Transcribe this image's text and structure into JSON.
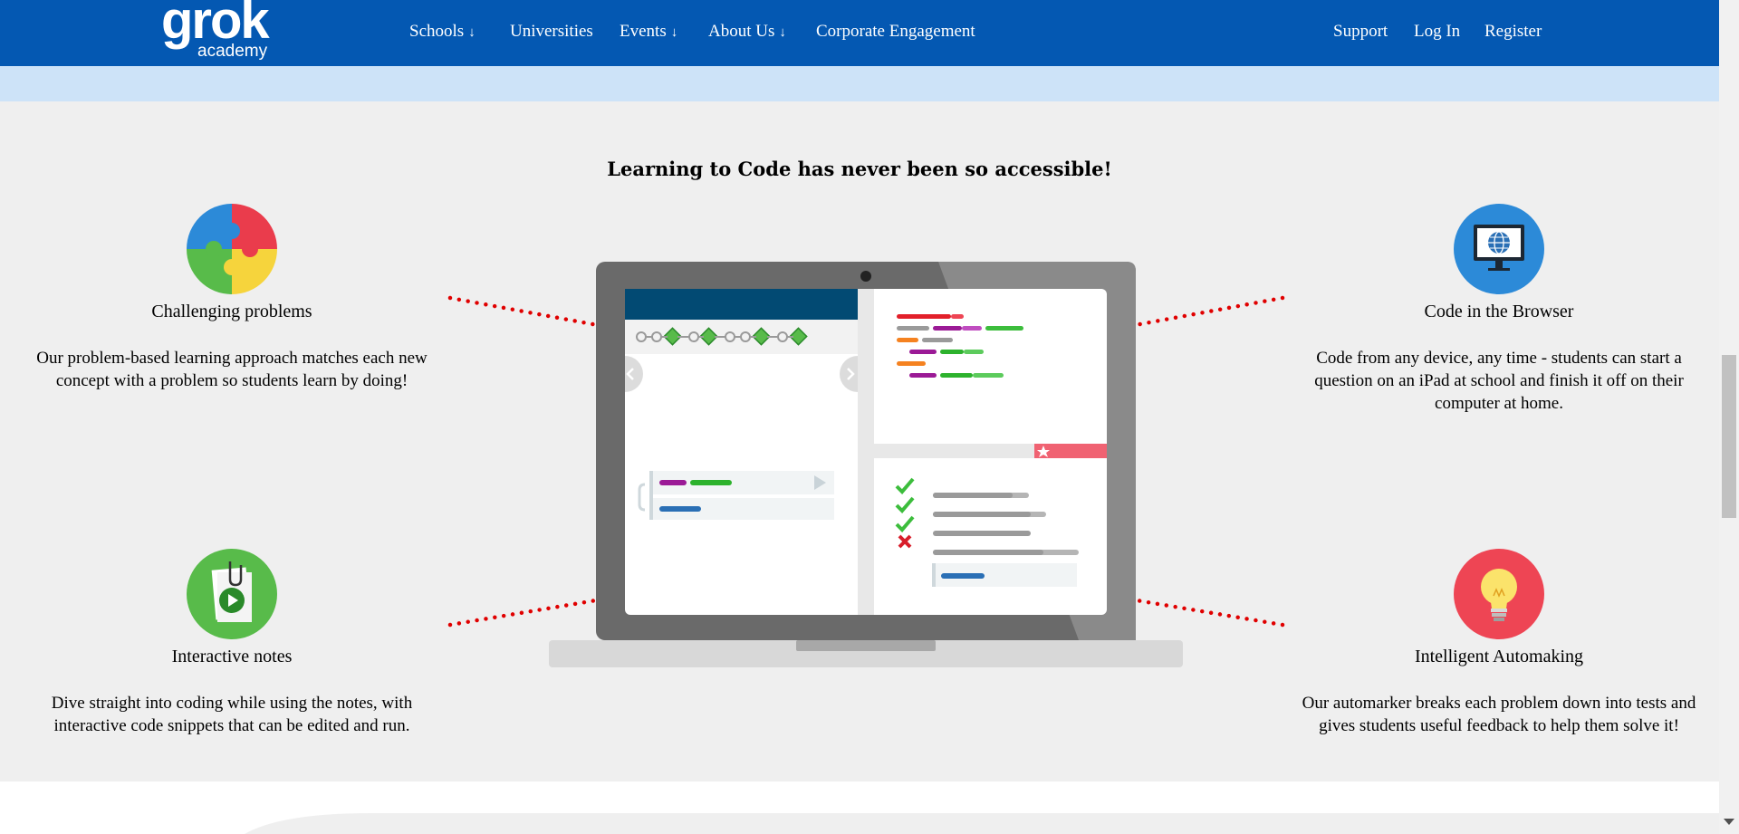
{
  "nav": {
    "logo": {
      "main": "grok",
      "sub": "academy"
    },
    "items": [
      {
        "label": "Schools",
        "dropdown": true
      },
      {
        "label": "Universities",
        "dropdown": false
      },
      {
        "label": "Events",
        "dropdown": true
      },
      {
        "label": "About Us",
        "dropdown": true
      },
      {
        "label": "Corporate Engagement",
        "dropdown": false
      }
    ],
    "dropdown_arrow": "↓",
    "right_items": [
      {
        "label": "Support"
      },
      {
        "label": "Log In"
      },
      {
        "label": "Register"
      }
    ]
  },
  "section": {
    "title": "Learning to Code has never been so accessible!"
  },
  "features": [
    {
      "icon": "puzzle-icon",
      "title": "Challenging problems",
      "desc": "Our problem-based learning approach matches each new concept with a problem so students learn by doing!"
    },
    {
      "icon": "monitor-globe-icon",
      "title": "Code in the Browser",
      "desc": "Code from any device, any time - students can start a question on an iPad at school and finish it off on their computer at home."
    },
    {
      "icon": "notes-icon",
      "title": "Interactive notes",
      "desc": "Dive straight into coding while using the notes, with interactive code snippets that can be edited and run."
    },
    {
      "icon": "lightbulb-icon",
      "title": "Intelligent Automaking",
      "desc": "Our automarker breaks each problem down into tests and gives students useful feedback to help them solve it!"
    }
  ],
  "colors": {
    "nav_bg": "#0458b2",
    "subbar_bg": "#cde3f8",
    "page_bg": "#efefef",
    "dotted_line": "#e00000",
    "code_red": "#e2202a",
    "code_green": "#3cbd3c",
    "code_purple": "#9b1a96",
    "code_orange": "#f58220",
    "code_blue": "#2a6fb5"
  }
}
